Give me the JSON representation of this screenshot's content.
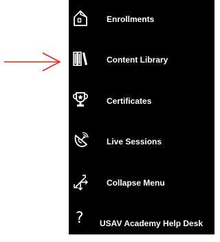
{
  "annotation": {
    "arrow_color": "#e8211c",
    "arrow_icon": "red-arrow-right"
  },
  "menu": {
    "background": "#000000",
    "text_color": "#ffffff",
    "items": [
      {
        "label": "Enrollments",
        "icon": "home-icon"
      },
      {
        "label": "Content Library",
        "icon": "books-icon"
      },
      {
        "label": "Certificates",
        "icon": "trophy-icon"
      },
      {
        "label": "Live Sessions",
        "icon": "satellite-dish-icon"
      },
      {
        "label": "Collapse Menu",
        "icon": "collapse-arrows-icon"
      },
      {
        "label": "USAV Academy Help Desk",
        "icon": "help-question-icon",
        "glyph": "?"
      }
    ]
  }
}
